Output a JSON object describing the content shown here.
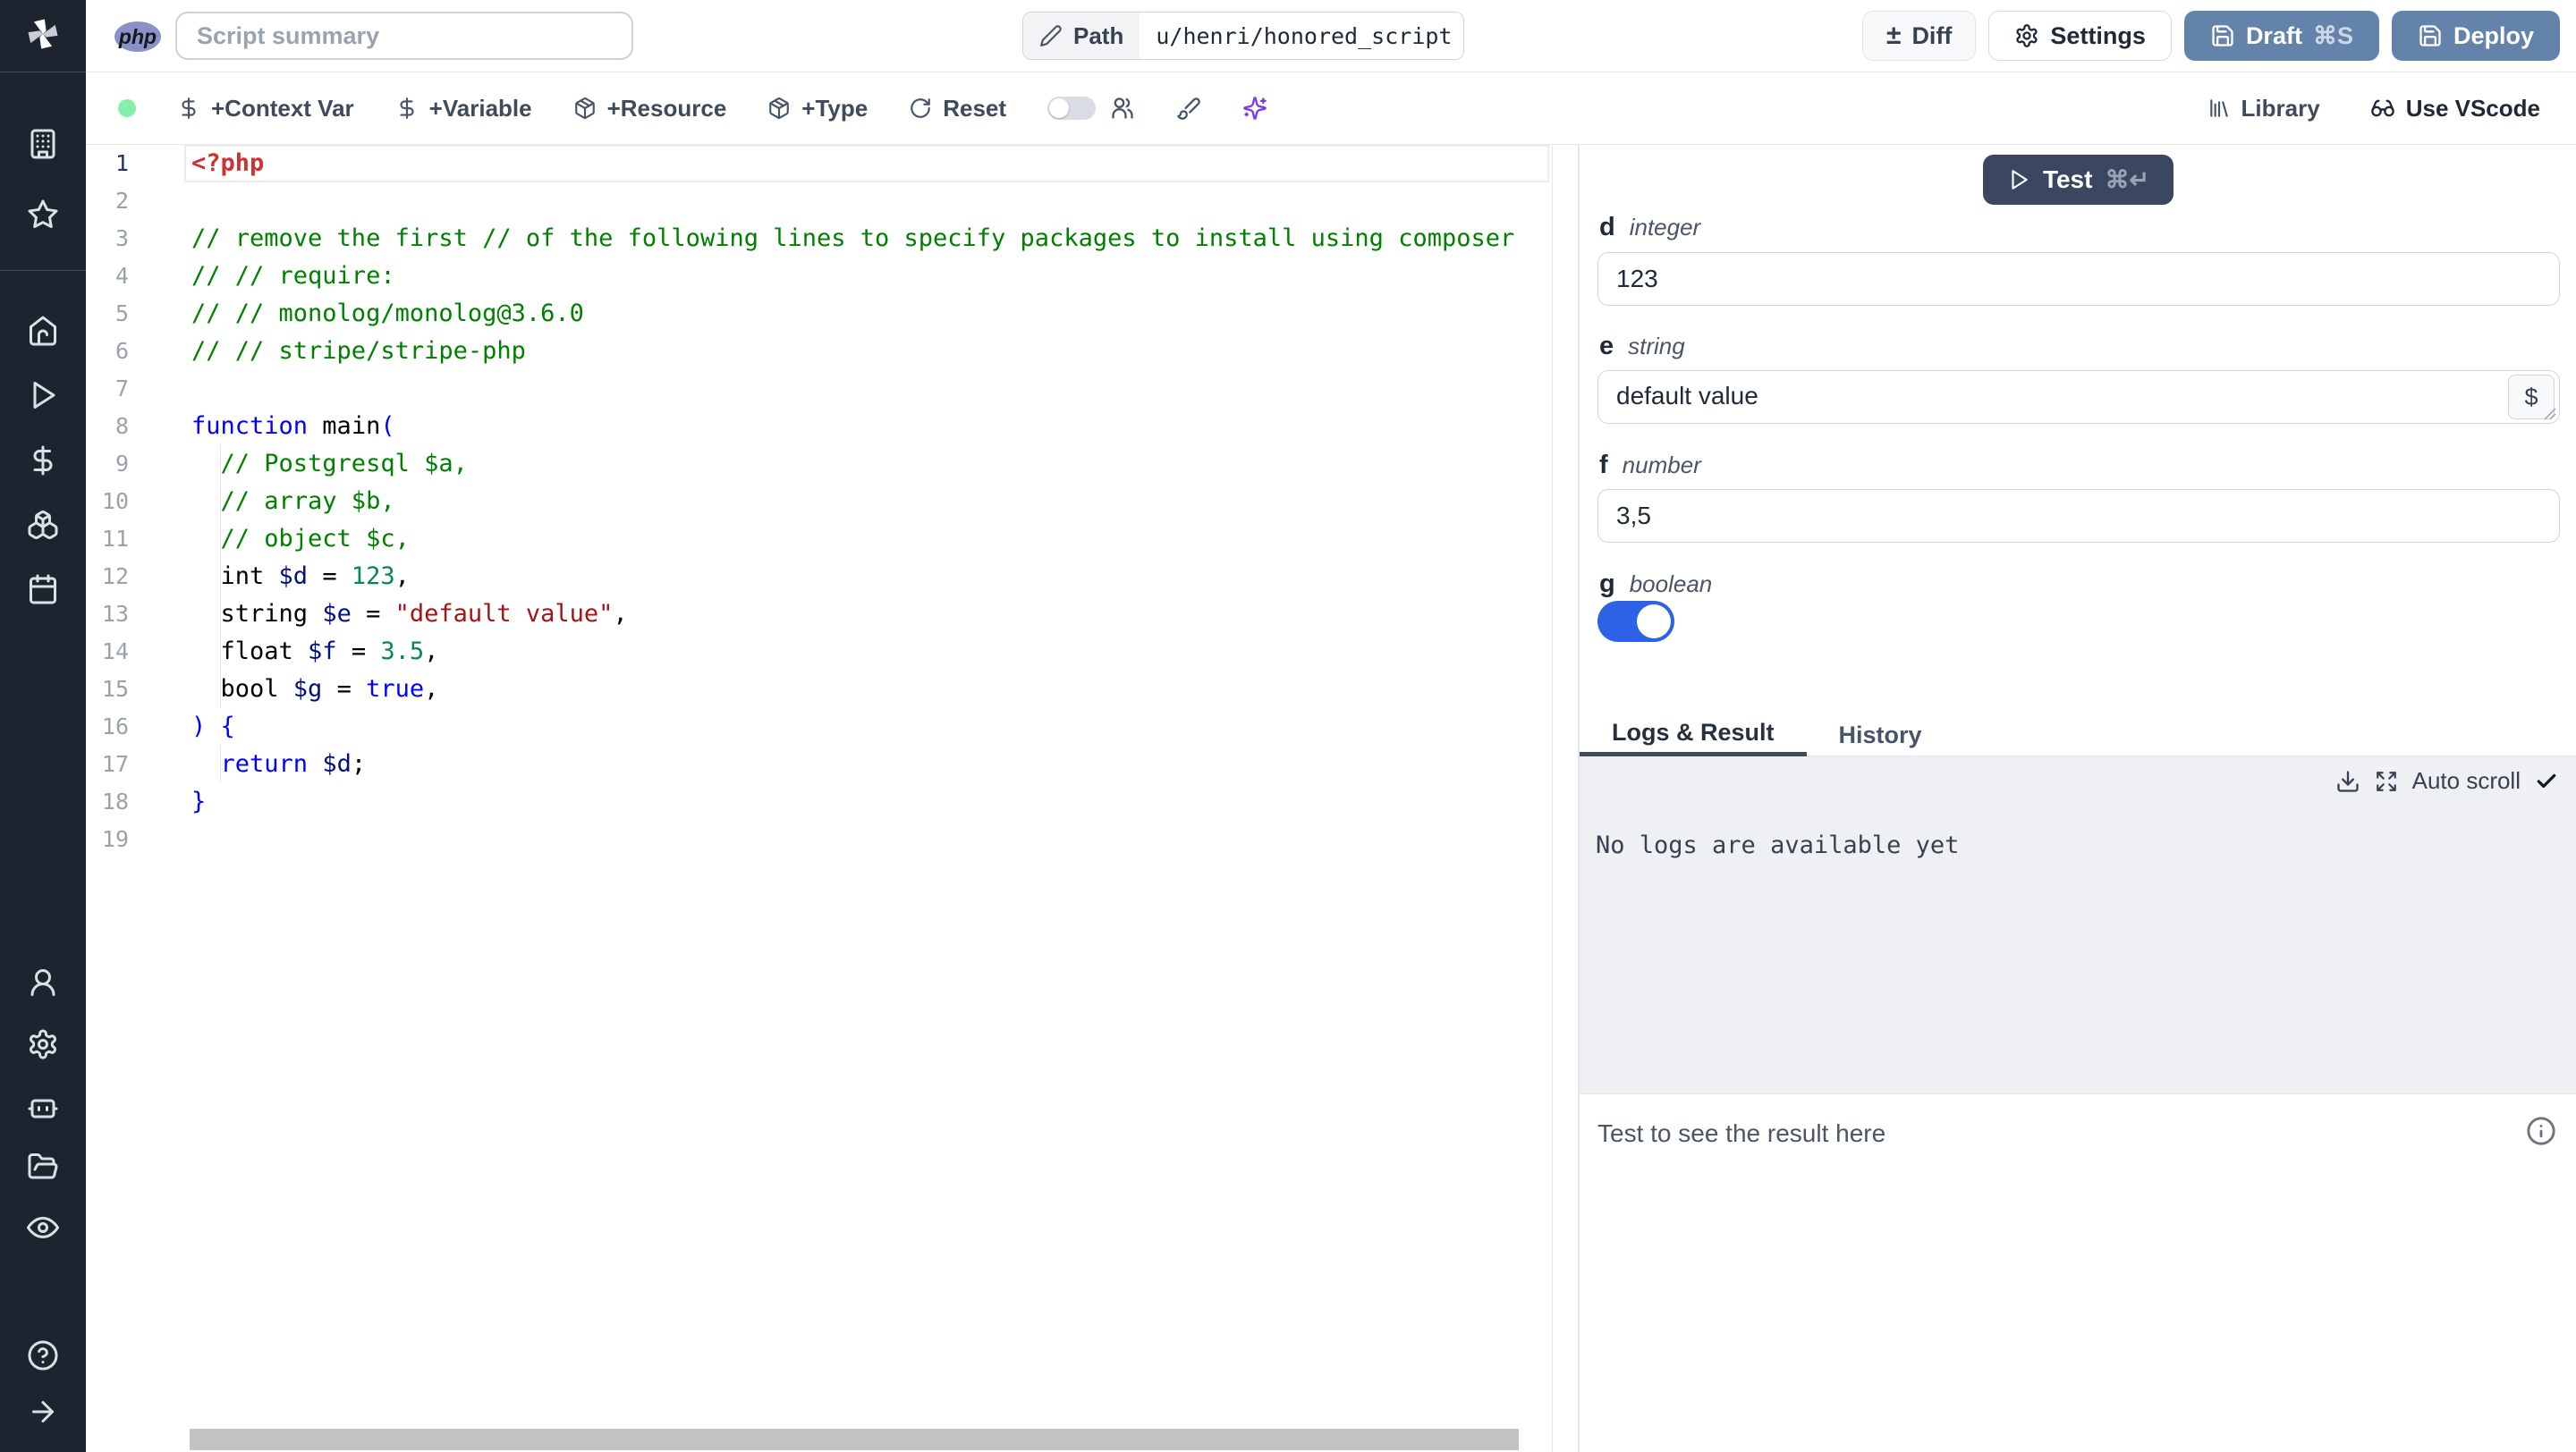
{
  "topbar": {
    "language_badge": "php",
    "summary_placeholder": "Script summary",
    "path_label": "Path",
    "path_value": "u/henri/honored_script",
    "diff_label": "Diff",
    "diff_glyph": "±",
    "settings_label": "Settings",
    "draft_label": "Draft",
    "draft_shortcut": "⌘S",
    "deploy_label": "Deploy"
  },
  "toolbar": {
    "context_var": "+Context Var",
    "variable": "+Variable",
    "resource": "+Resource",
    "type": "+Type",
    "reset": "Reset",
    "library": "Library",
    "use_vscode": "Use VScode",
    "status_color": "#86efac",
    "ai_color": "#7c3aed"
  },
  "sidebar": {
    "icons": [
      "windmill-logo",
      "workspace",
      "favorites",
      "home",
      "runs",
      "variables",
      "resources",
      "schedules",
      "user",
      "settings",
      "workers",
      "folders",
      "audit-logs",
      "help",
      "expand"
    ]
  },
  "editor": {
    "language": "php",
    "active_line": 1,
    "colors": {
      "tag": "#cd3131",
      "comment": "#008000",
      "keyword": "#0000ff",
      "var": "#001080",
      "num": "#098658",
      "str": "#a31515",
      "plain": "#000000"
    },
    "lines": [
      [
        [
          "<?php",
          "tag"
        ]
      ],
      [],
      [
        [
          "// remove the first // of the following lines to specify packages to install using composer",
          "comment"
        ]
      ],
      [
        [
          "// // require:",
          "comment"
        ]
      ],
      [
        [
          "// // monolog/monolog@3.6.0",
          "comment"
        ]
      ],
      [
        [
          "// // stripe/stripe-php",
          "comment"
        ]
      ],
      [],
      [
        [
          "function",
          "keyword"
        ],
        [
          " main",
          "plain"
        ],
        [
          "(",
          "keyword"
        ]
      ],
      [
        [
          "  // Postgresql $a,",
          "comment"
        ]
      ],
      [
        [
          "  // array $b,",
          "comment"
        ]
      ],
      [
        [
          "  // object $c,",
          "comment"
        ]
      ],
      [
        [
          "  int ",
          "plain"
        ],
        [
          "$d",
          "var"
        ],
        [
          " = ",
          "plain"
        ],
        [
          "123",
          "num"
        ],
        [
          ",",
          "plain"
        ]
      ],
      [
        [
          "  string ",
          "plain"
        ],
        [
          "$e",
          "var"
        ],
        [
          " = ",
          "plain"
        ],
        [
          "\"default value\"",
          "str"
        ],
        [
          ",",
          "plain"
        ]
      ],
      [
        [
          "  float ",
          "plain"
        ],
        [
          "$f",
          "var"
        ],
        [
          " = ",
          "plain"
        ],
        [
          "3.5",
          "num"
        ],
        [
          ",",
          "plain"
        ]
      ],
      [
        [
          "  bool ",
          "plain"
        ],
        [
          "$g",
          "var"
        ],
        [
          " = ",
          "plain"
        ],
        [
          "true",
          "keyword"
        ],
        [
          ",",
          "plain"
        ]
      ],
      [
        [
          ") {",
          "keyword"
        ]
      ],
      [
        [
          "  ",
          "plain"
        ],
        [
          "return",
          "keyword"
        ],
        [
          " ",
          "plain"
        ],
        [
          "$d",
          "var"
        ],
        [
          ";",
          "plain"
        ]
      ],
      [
        [
          "}",
          "keyword"
        ]
      ],
      []
    ]
  },
  "panel": {
    "test_label": "Test",
    "test_shortcut": "⌘↵",
    "fields": [
      {
        "name": "d",
        "type": "integer",
        "value": "123"
      },
      {
        "name": "e",
        "type": "string",
        "value": "default value"
      },
      {
        "name": "f",
        "type": "number",
        "value": "3,5"
      },
      {
        "name": "g",
        "type": "boolean",
        "value": true
      }
    ],
    "tabs": {
      "logs": "Logs & Result",
      "history": "History"
    },
    "auto_scroll_label": "Auto scroll",
    "no_logs_text": "No logs are available yet",
    "result_placeholder": "Test to see the result here"
  }
}
